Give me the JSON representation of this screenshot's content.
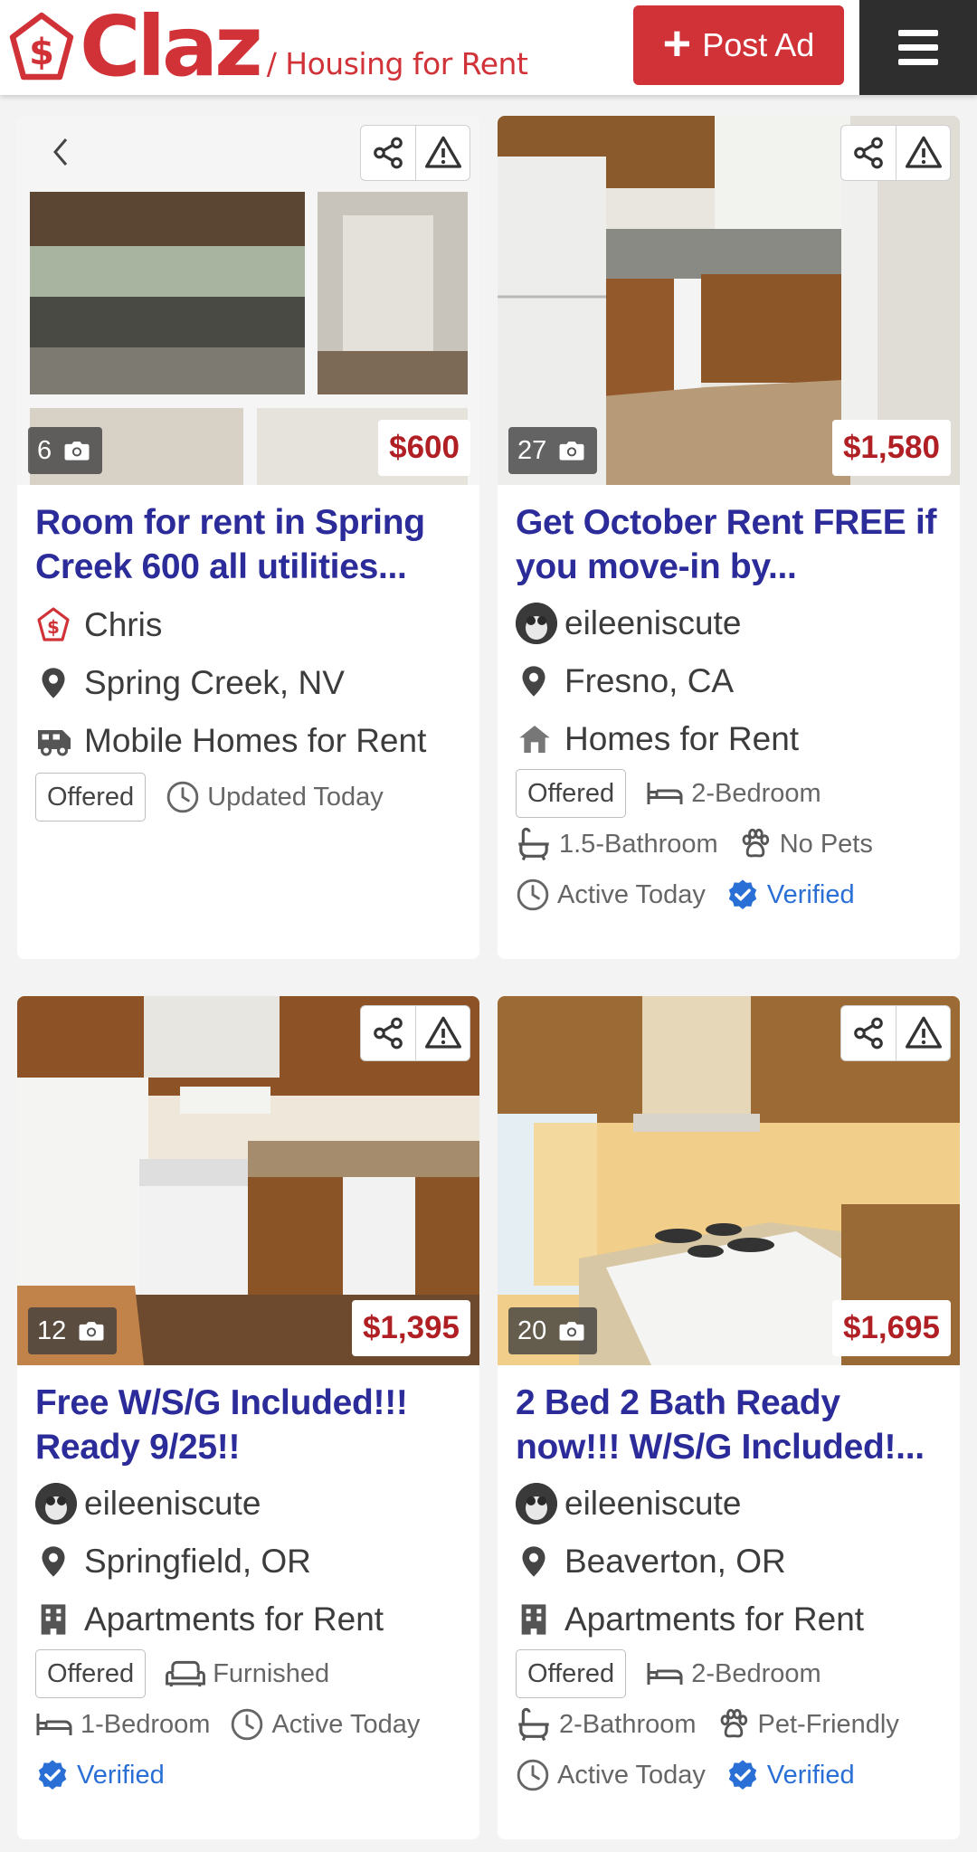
{
  "header": {
    "brand": "Claz",
    "section": "/ Housing for Rent",
    "post_ad_label": "Post Ad"
  },
  "colors": {
    "brand_red": "#d13238",
    "title_blue": "#2b2c9a",
    "price_red": "#b01f24",
    "verified_blue": "#2a6fd6"
  },
  "listings": [
    {
      "photo_count": "6",
      "price": "$600",
      "title": "Room for rent in Spring Creek 600 all utilities...",
      "poster": "Chris",
      "location": "Spring Creek, NV",
      "category": "Mobile Homes for Rent",
      "tags": [
        "Offered"
      ],
      "updated": "Updated Today"
    },
    {
      "photo_count": "27",
      "price": "$1,580",
      "title": "Get October Rent FREE if you move-in by...",
      "poster": "eileeniscute",
      "location": "Fresno, CA",
      "category": "Homes for Rent",
      "tags": [
        "Offered",
        "2-Bedroom",
        "1.5-Bathroom",
        "No Pets"
      ],
      "updated": "Active Today",
      "verified": "Verified"
    },
    {
      "photo_count": "12",
      "price": "$1,395",
      "title": "Free W/S/G Included!!! Ready 9/25!!",
      "poster": "eileeniscute",
      "location": "Springfield, OR",
      "category": "Apartments for Rent",
      "tags": [
        "Offered",
        "Furnished",
        "1-Bedroom"
      ],
      "updated": "Active Today",
      "verified": "Verified"
    },
    {
      "photo_count": "20",
      "price": "$1,695",
      "title": "2 Bed 2 Bath Ready now!!! W/S/G Included!...",
      "poster": "eileeniscute",
      "location": "Beaverton, OR",
      "category": "Apartments for Rent",
      "tags": [
        "Offered",
        "2-Bedroom",
        "2-Bathroom",
        "Pet-Friendly"
      ],
      "updated": "Active Today",
      "verified": "Verified"
    }
  ]
}
